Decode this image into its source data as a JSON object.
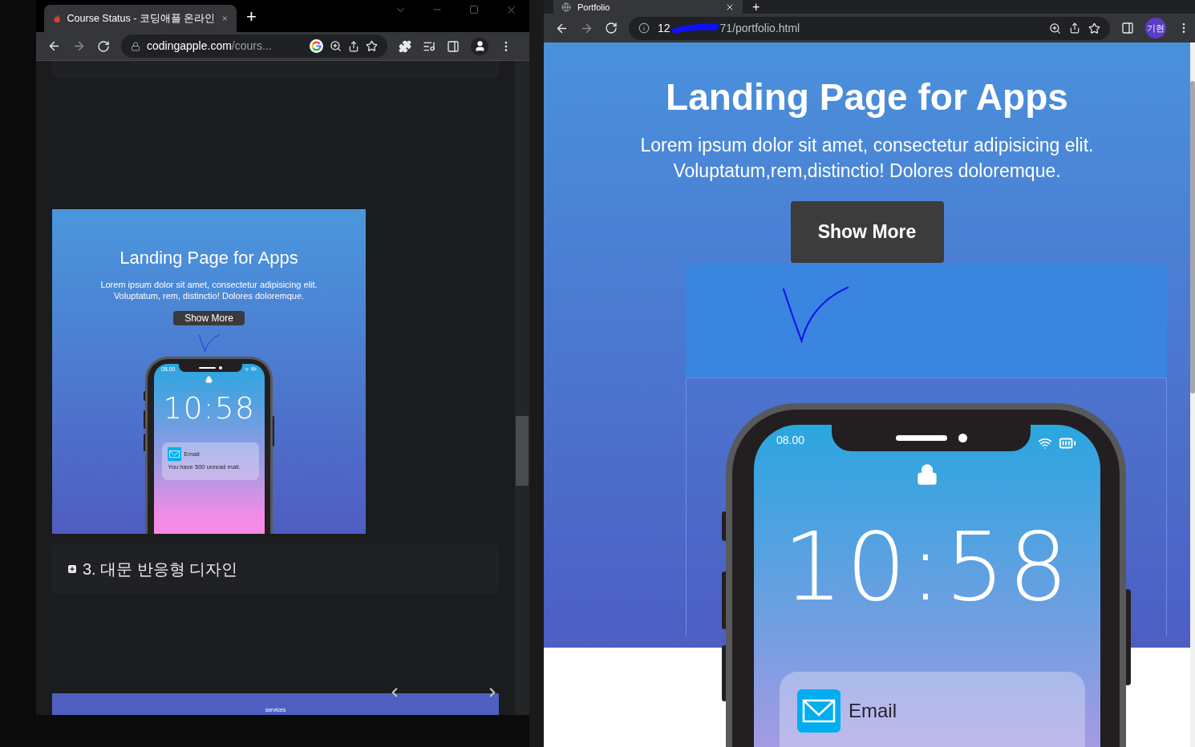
{
  "left_window": {
    "tab": {
      "title": "Course Status - 코딩애플 온라인"
    },
    "new_tab": "+",
    "url_host": "codingapple.com",
    "url_path": "/cours...",
    "preview": {
      "title": "Landing Page for Apps",
      "lines": [
        "Lorem ipsum dolor sit amet, consectetur adipisicing elit.",
        "Voluptatum, rem, distinctio! Dolores doloremque."
      ],
      "button": "Show More",
      "phone": {
        "status_time": "08.00",
        "time": "10:58",
        "notification": {
          "app": "Email",
          "message": "You have 500 unread mail."
        }
      }
    },
    "accordion": [
      {
        "label": "3. 대문 반응형 디자인",
        "expanded": false
      }
    ],
    "band": {
      "caption": "services"
    }
  },
  "right_window": {
    "tab": {
      "title": "Portfolio"
    },
    "new_tab": "+",
    "url_start": "12",
    "url_end": "71/portfolio.html",
    "profile": "기현",
    "hero": {
      "title": "Landing Page for Apps",
      "lines": [
        "Lorem ipsum dolor sit amet, consectetur adipisicing elit.",
        "Voluptatum,rem,distinctio! Dolores doloremque."
      ],
      "button": "Show More",
      "phone": {
        "status_time": "08.00",
        "time": "10:58",
        "notification": {
          "app": "Email"
        }
      }
    }
  }
}
